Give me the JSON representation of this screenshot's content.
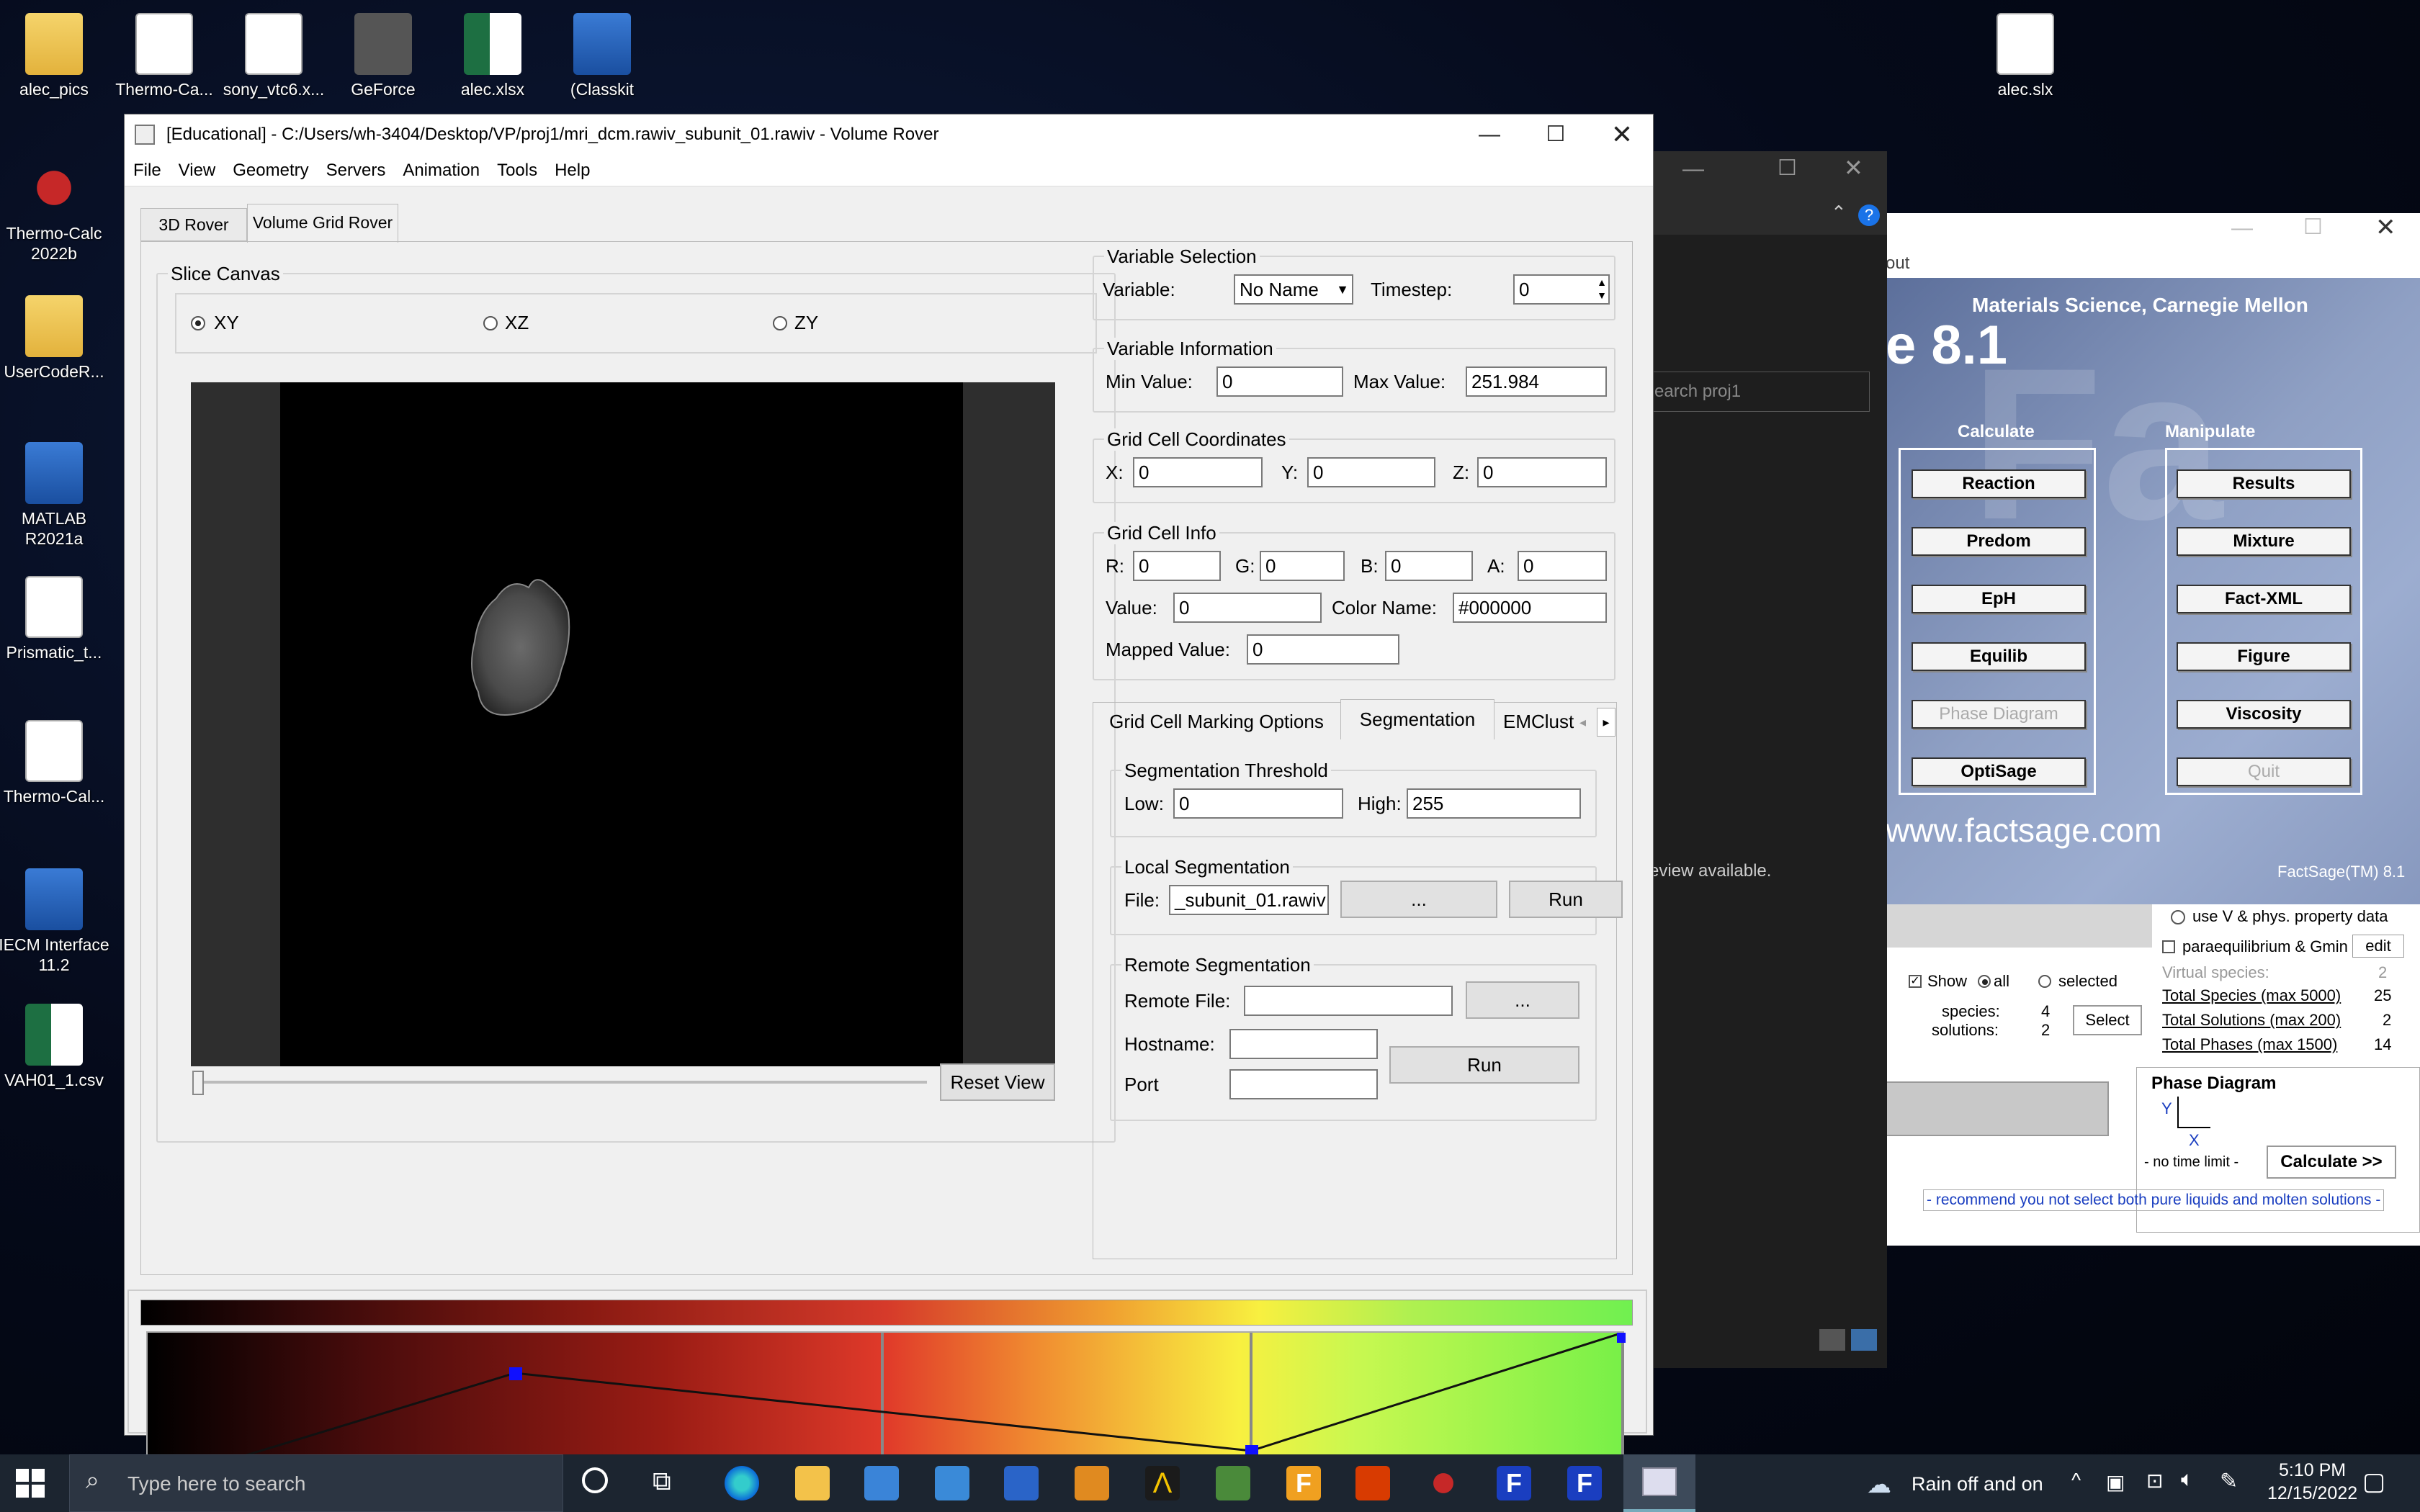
{
  "desktop_icons": [
    {
      "label": "alec_pics",
      "type": "folder"
    },
    {
      "label": "Thermo-Ca...",
      "type": "doc"
    },
    {
      "label": "sony_vtc6.x...",
      "type": "doc"
    },
    {
      "label": "GeForce",
      "type": "gray"
    },
    {
      "label": "alec.xlsx",
      "type": "excel"
    },
    {
      "label": "(Classkit",
      "type": "blue"
    },
    {
      "label": "alec.slx",
      "type": "doc"
    },
    {
      "label": "Thermo-Calc 2022b",
      "type": "red"
    },
    {
      "label": "UserCodeR...",
      "type": "folder"
    },
    {
      "label": "MATLAB R2021a",
      "type": "blue"
    },
    {
      "label": "Prismatic_t...",
      "type": "doc"
    },
    {
      "label": "Thermo-Cal...",
      "type": "doc"
    },
    {
      "label": "IECM Interface 11.2",
      "type": "blue"
    },
    {
      "label": "VAH01_1.csv",
      "type": "excel"
    }
  ],
  "main_window": {
    "title": "[Educational] - C:/Users/wh-3404/Desktop/VP/proj1/mri_dcm.rawiv_subunit_01.rawiv - Volume Rover",
    "menu": [
      "File",
      "View",
      "Geometry",
      "Servers",
      "Animation",
      "Tools",
      "Help"
    ],
    "tabs": [
      "3D Rover",
      "Volume Grid Rover"
    ],
    "slice_canvas": {
      "title": "Slice Canvas",
      "options": [
        "XY",
        "XZ",
        "ZY"
      ],
      "selected": "XY",
      "reset_label": "Reset View"
    },
    "variable_selection": {
      "title": "Variable Selection",
      "variable_label": "Variable:",
      "variable_value": "No Name",
      "timestep_label": "Timestep:",
      "timestep_value": "0"
    },
    "variable_information": {
      "title": "Variable Information",
      "min_label": "Min Value:",
      "min_value": "0",
      "max_label": "Max Value:",
      "max_value": "251.984"
    },
    "grid_cell_coordinates": {
      "title": "Grid Cell Coordinates",
      "x_label": "X:",
      "x_value": "0",
      "y_label": "Y:",
      "y_value": "0",
      "z_label": "Z:",
      "z_value": "0"
    },
    "grid_cell_info": {
      "title": "Grid Cell Info",
      "r_label": "R:",
      "r_value": "0",
      "g_label": "G:",
      "g_value": "0",
      "b_label": "B:",
      "b_value": "0",
      "a_label": "A:",
      "a_value": "0",
      "value_label": "Value:",
      "value_value": "0",
      "color_name_label": "Color Name:",
      "color_name_value": "#000000",
      "mapped_label": "Mapped Value:",
      "mapped_value": "0"
    },
    "lower_tabs": [
      "Grid Cell Marking Options",
      "Segmentation",
      "EMClust"
    ],
    "segmentation_threshold": {
      "title": "Segmentation Threshold",
      "low_label": "Low:",
      "low_value": "0",
      "high_label": "High:",
      "high_value": "255"
    },
    "local_segmentation": {
      "title": "Local Segmentation",
      "file_label": "File:",
      "file_value": "_subunit_01.rawiv",
      "browse_label": "...",
      "run_label": "Run"
    },
    "remote_segmentation": {
      "title": "Remote Segmentation",
      "remote_file_label": "Remote File:",
      "hostname_label": "Hostname:",
      "port_label": "Port",
      "browse_label": "...",
      "run_label": "Run"
    }
  },
  "background_window": {
    "search_placeholder": "earch proj1",
    "preview_text": "eview available."
  },
  "factsage": {
    "title_fragment": "out",
    "header": "Materials Science, Carnegie Mellon",
    "version": "e 8.1",
    "calculate_title": "Calculate",
    "manipulate_title": "Manipulate",
    "calculate_buttons": [
      "Reaction",
      "Predom",
      "EpH",
      "Equilib",
      "Phase Diagram",
      "OptiSage"
    ],
    "manipulate_buttons": [
      "Results",
      "Mixture",
      "Fact-XML",
      "Figure",
      "Viscosity",
      "Quit"
    ],
    "website": "www.factsage.com",
    "trademark": "FactSage(TM) 8.1",
    "use_v": "use V & phys. property data",
    "paraeq": "paraequilibrium & Gmin",
    "edit": "edit",
    "virtual_species": "Virtual species:",
    "virtual_species_value": "2",
    "totals": [
      {
        "label": "Total Species (max 5000)",
        "value": "25"
      },
      {
        "label": "Total Solutions (max 200)",
        "value": "2"
      },
      {
        "label": "Total Phases (max 1500)",
        "value": "14"
      }
    ],
    "show": "Show",
    "all": "all",
    "selected": "selected",
    "species_label": "species:",
    "species_value": "4",
    "solutions_label": "solutions:",
    "solutions_value": "2",
    "select_label": "Select",
    "phase_diagram_title": "Phase Diagram",
    "axis_y": "Y",
    "axis_x": "X",
    "no_time_limit": "- no time limit -",
    "calculate_label": "Calculate >>",
    "recommend": "- recommend you not select both pure liquids and molten solutions -"
  },
  "taskbar": {
    "search_placeholder": "Type here to search",
    "weather": "Rain off and on",
    "time": "5:10 PM",
    "date": "12/15/2022"
  },
  "colors": {
    "accent": "#0078d7",
    "taskbar": "#1c2530",
    "transfer_node": "#0000ff",
    "transfer_marker": "#e03030"
  }
}
